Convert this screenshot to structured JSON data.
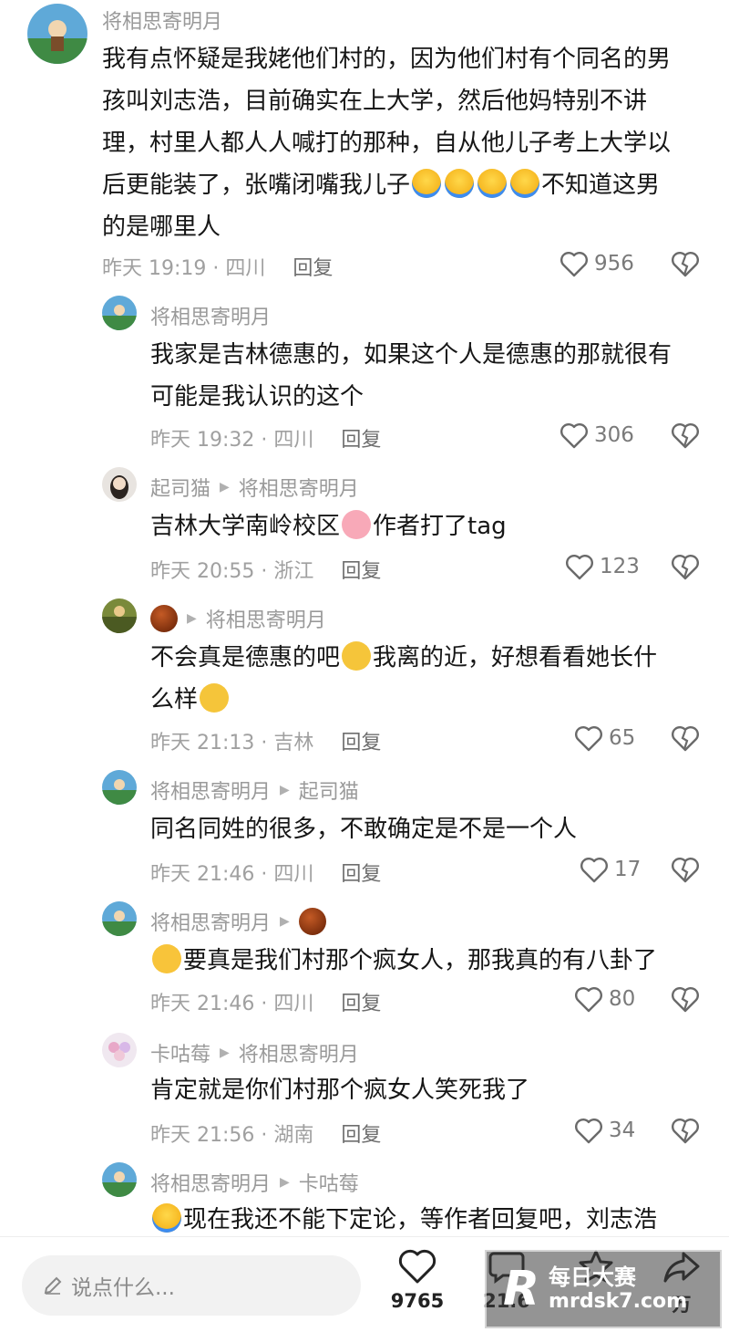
{
  "comments": [
    {
      "author": "将相思寄明月",
      "lines": [
        "我有点怀疑是我姥他们村的，因为他们村有个同名的男",
        "孩叫刘志浩，目前确实在上大学，然后他妈特别不讲",
        "理，村里人都人人喊打的那种，自从他儿子考上大学以",
        "后更能装了，张嘴闭嘴我儿子",
        "不知道这男",
        "的是哪里人"
      ],
      "time": "昨天 19:19 · 四川",
      "reply": "回复",
      "likes": "956"
    },
    {
      "author": "将相思寄明月",
      "lines": [
        "我家是吉林德惠的，如果这个人是德惠的那就很有",
        "可能是我认识的这个"
      ],
      "time": "昨天 19:32 · 四川",
      "reply": "回复",
      "likes": "306"
    },
    {
      "author": "起司猫",
      "reply_to": "将相思寄明月",
      "text_a": "吉林大学南岭校区",
      "text_b": "作者打了tag",
      "time": "昨天 20:55 · 浙江",
      "reply": "回复",
      "likes": "123"
    },
    {
      "reply_to": "将相思寄明月",
      "text_a": "不会真是德惠的吧",
      "text_b": "我离的近，好想看看她长什",
      "text_c": "么样",
      "time": "昨天 21:13 · 吉林",
      "reply": "回复",
      "likes": "65"
    },
    {
      "author": "将相思寄明月",
      "reply_to": "起司猫",
      "text_a": "同名同姓的很多，不敢确定是不是一个人",
      "time": "昨天 21:46 · 四川",
      "reply": "回复",
      "likes": "17"
    },
    {
      "author": "将相思寄明月",
      "text_a": "要真是我们村那个疯女人，那我真的有八卦了",
      "time": "昨天 21:46 · 四川",
      "reply": "回复",
      "likes": "80"
    },
    {
      "author": "卡咕莓",
      "reply_to": "将相思寄明月",
      "text_a": "肯定就是你们村那个疯女人笑死我了",
      "time": "昨天 21:56 · 湖南",
      "reply": "回复",
      "likes": "34"
    },
    {
      "author": "将相思寄明月",
      "reply_to": "卡咕莓",
      "text_a": "现在我还不能下定论，等作者回复吧，刘志浩"
    }
  ],
  "bottom": {
    "placeholder": "说点什么...",
    "like_count": "9765",
    "comment_count": "21.6",
    "share_count": "万"
  },
  "watermark": {
    "line1": "每日大赛",
    "line2": "mrdsk7.com"
  },
  "colors": {
    "text": "#161616",
    "meta": "#9a9a9a"
  }
}
